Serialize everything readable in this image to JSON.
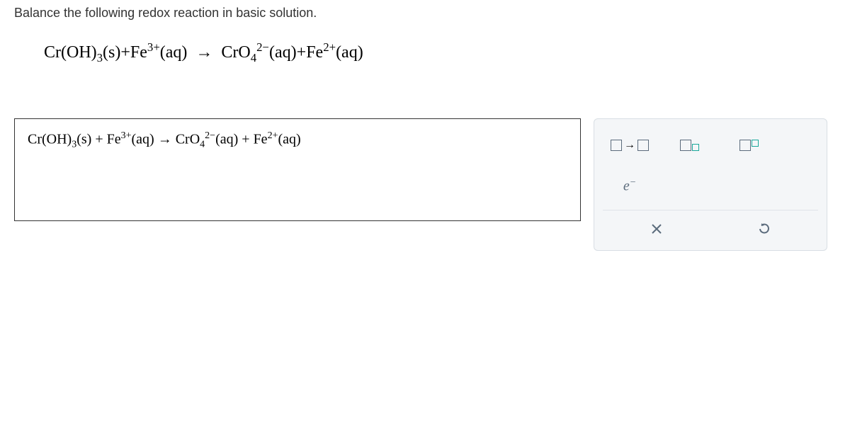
{
  "question": "Balance the following redox reaction in basic solution.",
  "equation": {
    "reactant1": "Cr(OH)",
    "r1_sub": "3",
    "r1_state": "(s)",
    "reactant2": "Fe",
    "r2_sup": "3+",
    "r2_state": "(aq)",
    "arrow": "→",
    "product1": "CrO",
    "p1_sub": "4",
    "p1_sup": "2−",
    "p1_state": "(aq)",
    "product2": "Fe",
    "p2_sup": "2+",
    "p2_state": "(aq)"
  },
  "answer": {
    "reactant1": "Cr(OH)",
    "r1_sub": "3",
    "r1_state": "(s)",
    "plus1": " + ",
    "reactant2": "Fe",
    "r2_sup": "3+",
    "r2_state": "(aq)",
    "arrow": " → ",
    "product1": "CrO",
    "p1_sub": "4",
    "p1_sup": "2−",
    "p1_state": "(aq)",
    "plus2": " + ",
    "product2": "Fe",
    "p2_sup": "2+",
    "p2_state": "(aq)"
  },
  "tools": {
    "electron": "e",
    "electron_sup": "−",
    "clear": "×",
    "reset": "↺"
  }
}
